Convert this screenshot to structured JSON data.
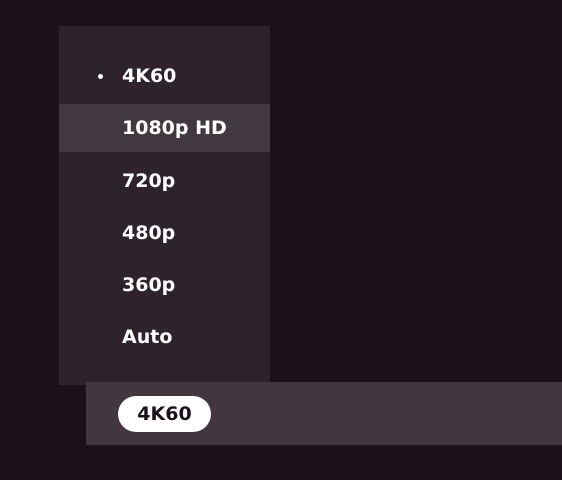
{
  "quality_menu": {
    "items": [
      {
        "label": "4K60",
        "selected": true
      },
      {
        "label": "1080p HD",
        "hovered": true
      },
      {
        "label": "720p"
      },
      {
        "label": "480p"
      },
      {
        "label": "360p"
      },
      {
        "label": "Auto"
      }
    ]
  },
  "control_bar": {
    "current_quality": "4K60"
  }
}
